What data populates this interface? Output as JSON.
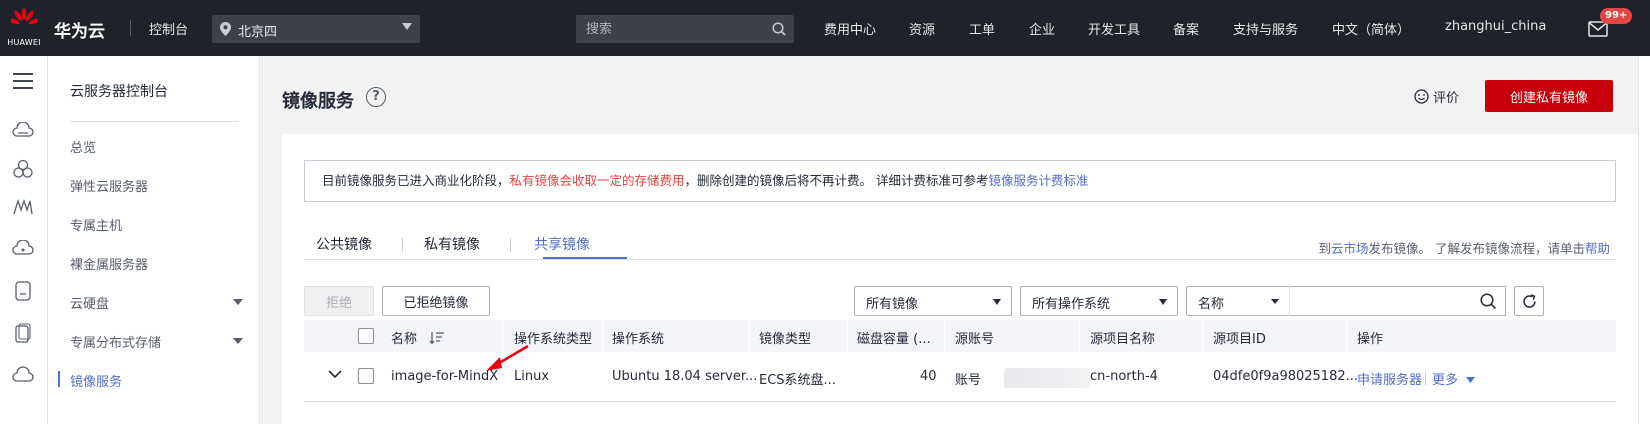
{
  "topbar": {
    "logo_text": "HUAWEI",
    "brand": "华为云",
    "console": "控制台",
    "region": "北京四",
    "search_placeholder": "搜索",
    "nav": [
      "费用中心",
      "资源",
      "工单",
      "企业",
      "开发工具",
      "备案",
      "支持与服务",
      "中文（简体）",
      "zhanghui_china"
    ],
    "badge": "99+"
  },
  "iconrail": {
    "icons": [
      "menu-icon",
      "cloud-server-icon",
      "network-icon",
      "storage-icon",
      "database-icon",
      "container-icon",
      "security-icon",
      "cloud-icon"
    ]
  },
  "subnav": {
    "title": "云服务器控制台",
    "items": [
      "总览",
      "弹性云服务器",
      "专属主机",
      "裸金属服务器",
      "云硬盘",
      "专属分布式存储",
      "镜像服务"
    ]
  },
  "page": {
    "title": "镜像服务",
    "rate": "评价",
    "create_label": "创建私有镜像"
  },
  "notice": {
    "part1": "目前镜像服务已进入商业化阶段，",
    "red": "私有镜像会收取一定的存储费用",
    "part2": "，删除创建的镜像后将不再计费。 详细计费标准可参考",
    "link": "镜像服务计费标准"
  },
  "tabs": {
    "items": [
      "公共镜像",
      "私有镜像",
      "共享镜像"
    ],
    "active": "共享镜像",
    "right_prefix": "到",
    "right_link1": "云市场",
    "right_mid": "发布镜像。 了解发布镜像流程，请单击",
    "right_link2": "帮助"
  },
  "toolbar": {
    "reject": "拒绝",
    "rejected": "已拒绝镜像",
    "filter_images": "所有镜像",
    "filter_os": "所有操作系统",
    "search_by": "名称"
  },
  "table": {
    "columns": [
      "名称",
      "操作系统类型",
      "操作系统",
      "镜像类型",
      "磁盘容量 (...",
      "源账号",
      "源项目名称",
      "源项目ID",
      "操作"
    ],
    "rows": [
      {
        "name": "image-for-MindX",
        "os_type": "Linux",
        "os": "Ubuntu 18.04 server...",
        "image_type": "ECS系统盘...",
        "disk": "40",
        "account": "账号",
        "project": "cn-north-4",
        "project_id": "04dfe0f9a98025182...",
        "action1": "申请服务器",
        "action2": "更多"
      }
    ]
  },
  "colors": {
    "topbar": "#1f2229",
    "accent": "#526ecc",
    "primary_button": "#c7000b",
    "warning_text": "#e54545"
  }
}
